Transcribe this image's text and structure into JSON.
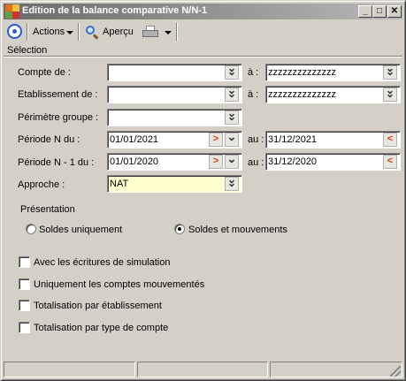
{
  "window": {
    "title": "Edition de la balance comparative N/N-1"
  },
  "title_buttons": {
    "minimize": "_",
    "maximize": "□",
    "close": "✕"
  },
  "toolbar": {
    "actions_label": "Actions",
    "apercu_label": "Aperçu"
  },
  "section": {
    "label": "Sélection"
  },
  "form": {
    "compte_de": {
      "label": "Compte de :",
      "value": "",
      "to_label": "à :",
      "to_value": "zzzzzzzzzzzzzz"
    },
    "etablissement_de": {
      "label": "Etablissement de :",
      "value": "",
      "to_label": "à :",
      "to_value": "zzzzzzzzzzzzzz"
    },
    "perimetre_groupe": {
      "label": "Périmètre groupe :",
      "value": ""
    },
    "periode_n": {
      "label": "Période N du :",
      "value": "01/01/2021",
      "to_label": "au :",
      "to_value": "31/12/2021"
    },
    "periode_n1": {
      "label": "Période N - 1 du :",
      "value": "01/01/2020",
      "to_label": "au :",
      "to_value": "31/12/2020"
    },
    "approche": {
      "label": "Approche :",
      "value": "NAT"
    }
  },
  "presentation": {
    "label": "Présentation",
    "options": [
      {
        "label": "Soldes uniquement",
        "selected": false
      },
      {
        "label": "Soldes et mouvements",
        "selected": true
      }
    ]
  },
  "checkboxes": [
    {
      "label": "Avec les écritures de simulation",
      "checked": false
    },
    {
      "label": "Uniquement les comptes mouvementés",
      "checked": false
    },
    {
      "label": "Totalisation par établissement",
      "checked": false
    },
    {
      "label": "Totalisation par type de compte",
      "checked": false
    }
  ]
}
